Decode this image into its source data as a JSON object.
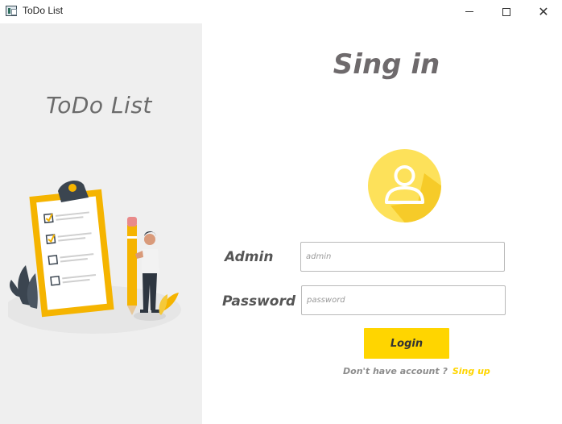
{
  "window": {
    "title": "ToDo List",
    "controls": {
      "minimize": "minimize-icon",
      "maximize": "maximize-icon",
      "close": "✕"
    }
  },
  "left": {
    "brand": "ToDo List",
    "illustration": "person-with-checklist-illustration"
  },
  "form": {
    "heading": "Sing in",
    "avatar": "user-icon",
    "admin_label": "Admin",
    "admin_placeholder": "admin",
    "password_label": "Password",
    "password_placeholder": "password",
    "login_label": "Login",
    "signup_prompt": "Don't have account ?",
    "signup_link": "Sing up"
  },
  "colors": {
    "accent": "#ffd500",
    "left_panel_bg": "#efefef",
    "text_gray": "#6e6a6c"
  }
}
